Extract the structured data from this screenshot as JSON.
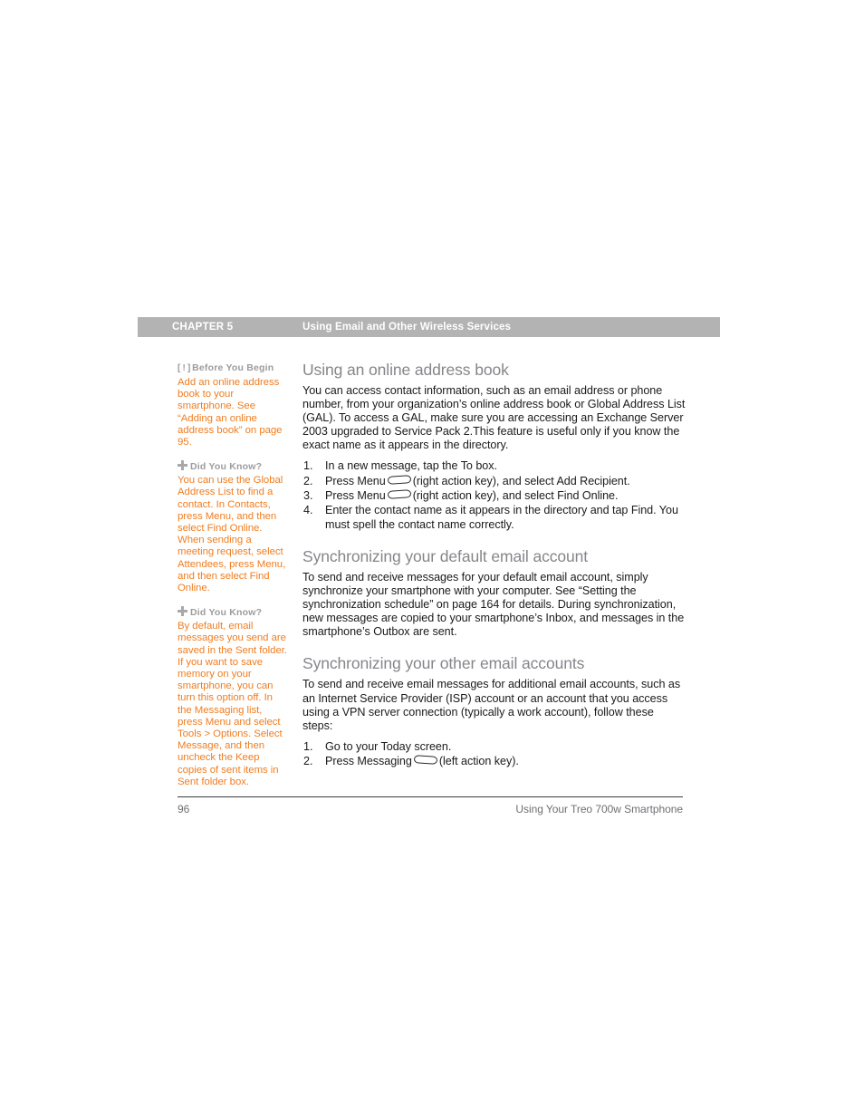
{
  "header": {
    "chapter_label": "CHAPTER 5",
    "chapter_title": "Using Email and Other Wireless Services",
    "bar_color": "#b3b3b3"
  },
  "sidebar": {
    "notes": [
      {
        "icon": "alert-bracket-icon",
        "icon_glyph": "[ ! ]",
        "heading": "Before You Begin",
        "body": "Add an online address book to your smartphone. See “Adding an online address book” on page 95."
      },
      {
        "icon": "plus-icon",
        "icon_glyph": "+",
        "heading": "Did You Know?",
        "body": "You can use the Global Address List to find a contact. In Contacts, press Menu, and then select Find Online. When sending a meeting request, select Attendees, press Menu, and then select Find Online."
      },
      {
        "icon": "plus-icon",
        "icon_glyph": "+",
        "heading": "Did You Know?",
        "body": "By default, email messages you send are saved in the Sent folder. If you want to save memory on your smartphone, you can turn this option off. In the Messaging list, press Menu and select Tools > Options. Select Message, and then uncheck the Keep copies of sent items in Sent folder box."
      }
    ],
    "note_text_color": "#f07d21",
    "note_heading_color": "#9c9c9c"
  },
  "main": {
    "sections": [
      {
        "title": "Using an online address book",
        "paragraph": "You can access contact information, such as an email address or phone number, from your organization’s online address book or Global Address List (GAL). To access a GAL, make sure you are accessing an Exchange Server 2003 upgraded to Service Pack 2.This feature is useful only if you know the exact name as it appears in the directory.",
        "steps": [
          {
            "num": "1.",
            "before": "In a new message, tap the To box.",
            "key": null,
            "after": ""
          },
          {
            "num": "2.",
            "before": "Press Menu",
            "key": "right-action-key-icon",
            "after": "(right action key), and select Add Recipient."
          },
          {
            "num": "3.",
            "before": "Press Menu",
            "key": "right-action-key-icon",
            "after": "(right action key), and select Find Online."
          },
          {
            "num": "4.",
            "before": "Enter the contact name as it appears in the directory and tap Find. You must spell the contact name correctly.",
            "key": null,
            "after": ""
          }
        ]
      },
      {
        "title": "Synchronizing your default email account",
        "paragraph": "To send and receive messages for your default email account, simply synchronize your smartphone with your computer. See “Setting the synchronization schedule” on page 164 for details. During synchronization, new messages are copied to your smartphone’s Inbox, and messages in the smartphone’s Outbox are sent.",
        "steps": []
      },
      {
        "title": "Synchronizing your other email accounts",
        "paragraph": "To send and receive email messages for additional email accounts, such as an Internet Service Provider (ISP) account or an account that you access using a VPN server connection (typically a work account), follow these steps:",
        "steps": [
          {
            "num": "1.",
            "before": "Go to your Today screen.",
            "key": null,
            "after": ""
          },
          {
            "num": "2.",
            "before": "Press Messaging",
            "key": "left-action-key-icon",
            "after": "(left action key)."
          }
        ]
      }
    ],
    "heading_color": "#85868a"
  },
  "footer": {
    "page_number": "96",
    "book_title": "Using Your Treo 700w Smartphone"
  }
}
